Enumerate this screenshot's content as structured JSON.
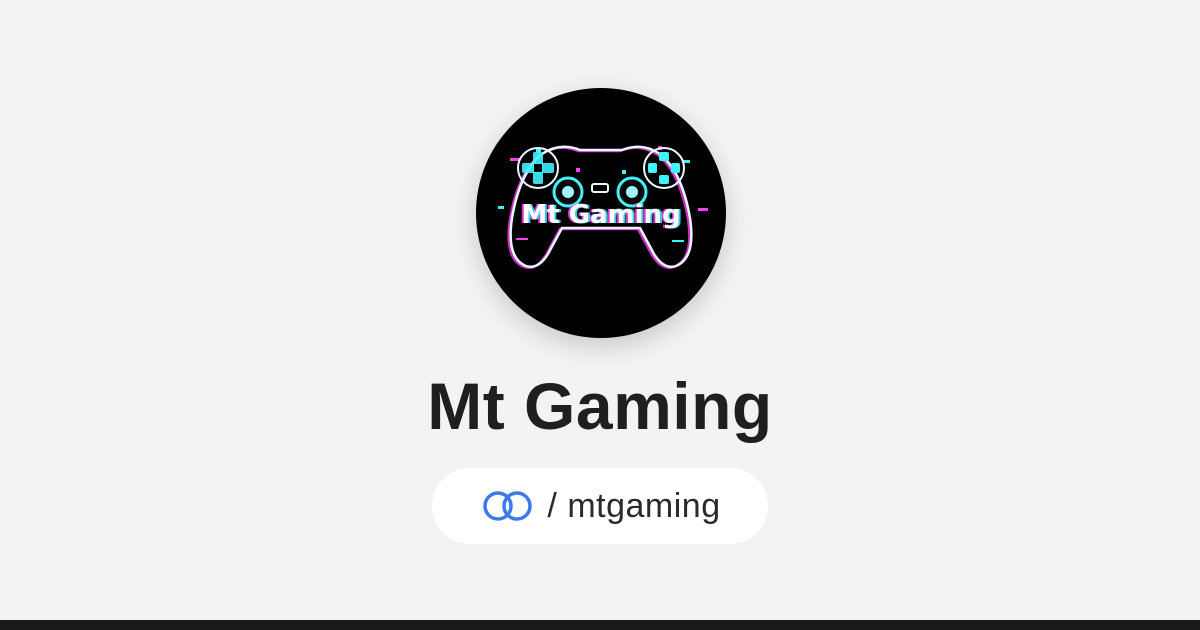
{
  "profile": {
    "logo_text": "Mt Gaming",
    "name": "Mt Gaming",
    "handle_separator": "/",
    "handle": "mtgaming"
  },
  "icons": {
    "avatar": "gamepad-logo",
    "handle": "link-rings-icon"
  },
  "colors": {
    "background": "#f3f3f5",
    "avatar_background": "#000000",
    "neon_cyan": "#3ff2ff",
    "neon_magenta": "#ff3df2",
    "title_text": "#1f1f22",
    "pill_background": "#ffffff",
    "link_icon": "#3b7ae8",
    "bottom_bar": "#1a1a1d"
  }
}
